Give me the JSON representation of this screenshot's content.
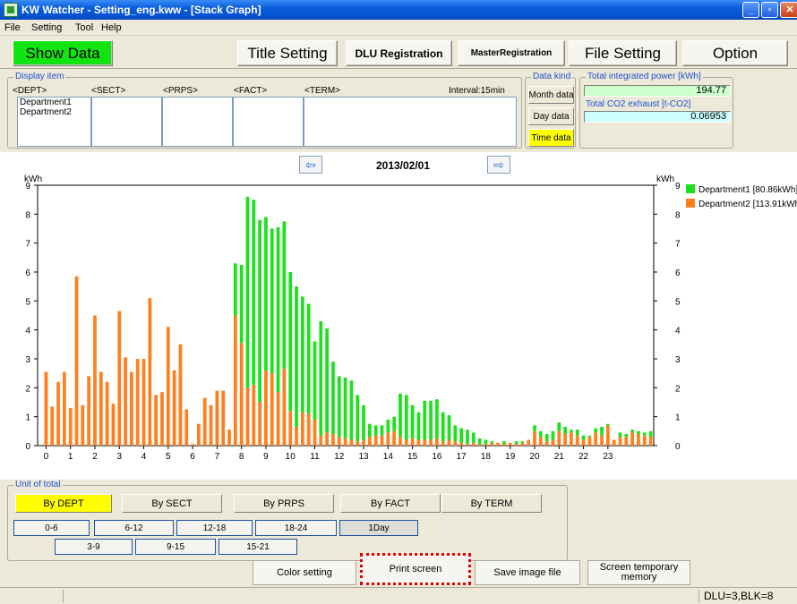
{
  "window": {
    "title": "KW Watcher - Setting_eng.kww - [Stack Graph]"
  },
  "menu": [
    "File",
    "Setting",
    "Tool",
    "Help"
  ],
  "toolbar": {
    "show_data": "Show Data",
    "title_setting": "Title Setting",
    "dlu_registration": "DLU Registration",
    "master_registration": "MasterRegistration",
    "file_setting": "File Setting",
    "option": "Option"
  },
  "display_item": {
    "label": "Display item",
    "columns": [
      "<DEPT>",
      "<SECT>",
      "<PRPS>",
      "<FACT>",
      "<TERM>"
    ],
    "interval": "Interval:15min",
    "dept_list": [
      "Department1",
      "Department2"
    ]
  },
  "data_kind": {
    "label": "Data kind",
    "month": "Month data",
    "day": "Day data",
    "time": "Time data",
    "selected": "time"
  },
  "totals": {
    "power_label": "Total integrated power [kWh]",
    "power_value": "194.77",
    "co2_label": "Total CO2 exhaust [t-CO2]",
    "co2_value": "0.06953"
  },
  "chart_header": {
    "date": "2013/02/01"
  },
  "chart_data": {
    "type": "bar",
    "stacked": true,
    "ylabel_left": "kWh",
    "ylabel_right": "kWh",
    "ylim": [
      0,
      9
    ],
    "yticks": [
      0,
      1,
      2,
      3,
      4,
      5,
      6,
      7,
      8,
      9
    ],
    "xticks": [
      "0",
      "1",
      "2",
      "3",
      "4",
      "5",
      "6",
      "7",
      "8",
      "9",
      "10",
      "11",
      "12",
      "13",
      "14",
      "15",
      "16",
      "17",
      "18",
      "19",
      "20",
      "21",
      "22",
      "23"
    ],
    "series": [
      {
        "name": "Department2 [113.91kWh]",
        "color": "#ff7f1f",
        "values": [
          2.55,
          1.35,
          2.2,
          2.55,
          1.3,
          5.85,
          1.4,
          2.4,
          4.5,
          2.55,
          2.2,
          1.45,
          4.65,
          3.05,
          2.55,
          3.0,
          3.0,
          5.1,
          1.75,
          1.85,
          4.1,
          2.6,
          3.5,
          1.25,
          0.05,
          0.75,
          1.65,
          1.4,
          1.9,
          1.9,
          0.55,
          4.5,
          3.55,
          2.0,
          2.1,
          1.5,
          2.6,
          2.5,
          1.85,
          2.65,
          1.2,
          0.65,
          1.15,
          1.1,
          0.9,
          0.35,
          0.45,
          0.4,
          0.3,
          0.25,
          0.2,
          0.15,
          0.2,
          0.3,
          0.35,
          0.35,
          0.45,
          0.5,
          0.3,
          0.2,
          0.25,
          0.2,
          0.2,
          0.2,
          0.25,
          0.15,
          0.2,
          0.15,
          0.1,
          0.05,
          0.1,
          0.05,
          0.05,
          0.1,
          0.1,
          0.05,
          0.1,
          0.05,
          0.1,
          0.2,
          0.5,
          0.3,
          0.15,
          0.2,
          0.5,
          0.4,
          0.45,
          0.35,
          0.2,
          0.3,
          0.45,
          0.35,
          0.7,
          0.2,
          0.3,
          0.3,
          0.45,
          0.4,
          0.35,
          0.3
        ]
      },
      {
        "name": "Department1 [80.86kWh]",
        "color": "#1fe01f",
        "values": [
          0,
          0,
          0,
          0,
          0,
          0,
          0,
          0,
          0,
          0,
          0,
          0,
          0,
          0,
          0,
          0,
          0,
          0,
          0,
          0,
          0,
          0,
          0,
          0,
          0,
          0,
          0,
          0,
          0,
          0,
          0,
          1.8,
          2.7,
          6.6,
          6.4,
          6.3,
          5.3,
          5.0,
          5.7,
          5.1,
          4.8,
          4.85,
          4.0,
          3.8,
          2.7,
          3.95,
          3.6,
          2.5,
          2.1,
          2.1,
          2.05,
          1.6,
          1.2,
          0.45,
          0.35,
          0.35,
          0.45,
          0.5,
          1.5,
          1.55,
          1.15,
          0.95,
          1.35,
          1.35,
          1.35,
          1.0,
          0.85,
          0.55,
          0.5,
          0.5,
          0.35,
          0.2,
          0.15,
          0.05,
          0.0,
          0.1,
          0.0,
          0.1,
          0.05,
          0.0,
          0.2,
          0.2,
          0.25,
          0.3,
          0.3,
          0.25,
          0.1,
          0.2,
          0.15,
          0.05,
          0.15,
          0.3,
          0.05,
          0.0,
          0.15,
          0.1,
          0.1,
          0.1,
          0.1,
          0.2
        ]
      }
    ]
  },
  "unit_of_total": {
    "label": "Unit of total",
    "buttons": [
      "By DEPT",
      "By SECT",
      "By PRPS",
      "By FACT",
      "By TERM"
    ],
    "selected": "By DEPT",
    "ranges_row1": [
      "0-6",
      "6-12",
      "12-18",
      "18-24",
      "1Day"
    ],
    "ranges_row2": [
      "3-9",
      "9-15",
      "15-21"
    ]
  },
  "actions": {
    "color_setting": "Color setting",
    "print_screen": "Print screen",
    "save_image": "Save image file",
    "screen_temp_line1": "Screen temporary",
    "screen_temp_line2": "memory"
  },
  "status": {
    "dlu": "DLU=3,BLK=8"
  },
  "colors": {
    "show_data_bg": "#12e412",
    "selected_yellow": "#ffff00",
    "highlight_dotted": "#e00000"
  }
}
